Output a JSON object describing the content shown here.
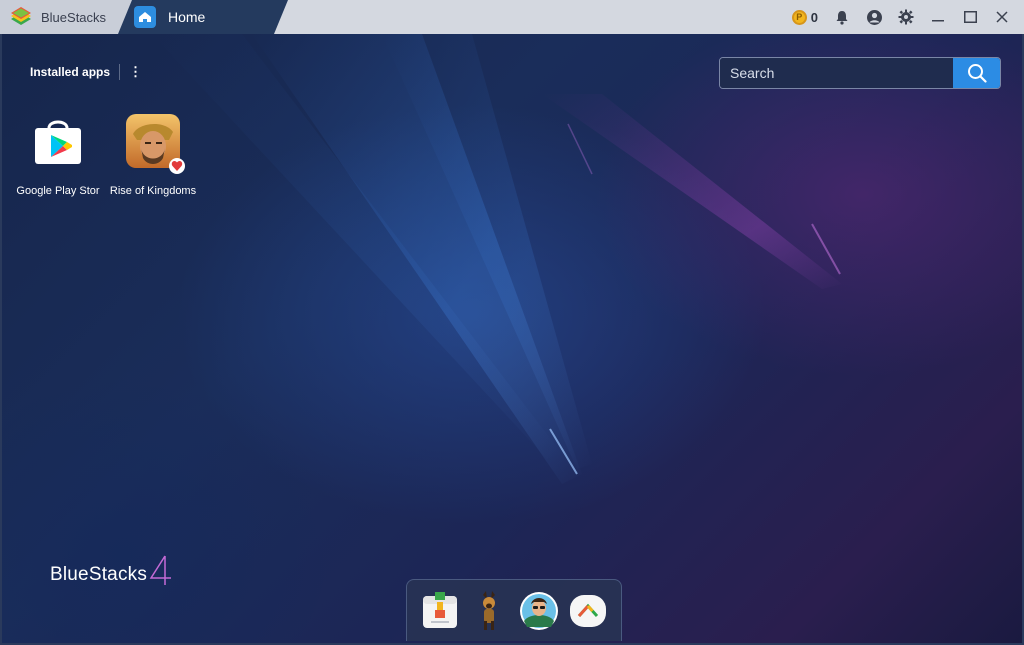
{
  "titlebar": {
    "app_name": "BlueStacks",
    "tab_label": "Home",
    "coin_count": "0",
    "icons": [
      "coin-icon",
      "bell-icon",
      "account-icon",
      "gear-icon",
      "minimize-icon",
      "maximize-icon",
      "close-icon"
    ]
  },
  "main": {
    "installed_label": "Installed apps",
    "more_label": "⋮",
    "search": {
      "placeholder": "Search",
      "value": ""
    },
    "apps": [
      {
        "label": "Google Play Stor",
        "icon": "google-play-store-icon"
      },
      {
        "label": "Rise of Kingdoms",
        "icon": "rise-of-kingdoms-icon"
      }
    ],
    "brand_text": "BlueStacks",
    "dock": [
      "app-center-icon",
      "dog-game-icon",
      "avatar-game-icon",
      "arc-app-icon"
    ]
  },
  "colors": {
    "accent": "#2c8ce4",
    "titlebar_bg": "#d4d8e0",
    "tab_bg": "#243a5e",
    "background": "#1a2d5a",
    "coin": "#f2b51d"
  }
}
